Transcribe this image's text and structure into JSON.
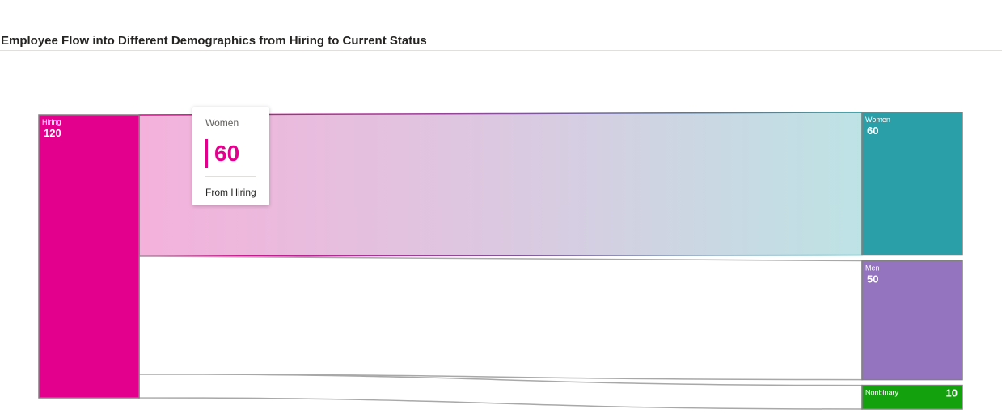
{
  "title": "Employee Flow into Different Demographics from Hiring to Current Status",
  "chart_data": {
    "type": "sankey",
    "nodes": [
      {
        "id": "hiring",
        "label": "Hiring",
        "value": 120,
        "column": 0,
        "color": "#e3008c"
      },
      {
        "id": "women",
        "label": "Women",
        "value": 60,
        "column": 1,
        "color": "#2b9fa8"
      },
      {
        "id": "men",
        "label": "Men",
        "value": 50,
        "column": 1,
        "color": "#9474bf"
      },
      {
        "id": "nonbinary",
        "label": "Nonbinary",
        "value": 10,
        "column": 1,
        "color": "#13a10e"
      }
    ],
    "links": [
      {
        "source": "hiring",
        "target": "women",
        "value": 60,
        "highlighted": true
      },
      {
        "source": "hiring",
        "target": "men",
        "value": 50,
        "highlighted": false
      },
      {
        "source": "hiring",
        "target": "nonbinary",
        "value": 10,
        "highlighted": false
      }
    ]
  },
  "tooltip": {
    "name": "Women",
    "value": "60",
    "source": "From Hiring"
  }
}
